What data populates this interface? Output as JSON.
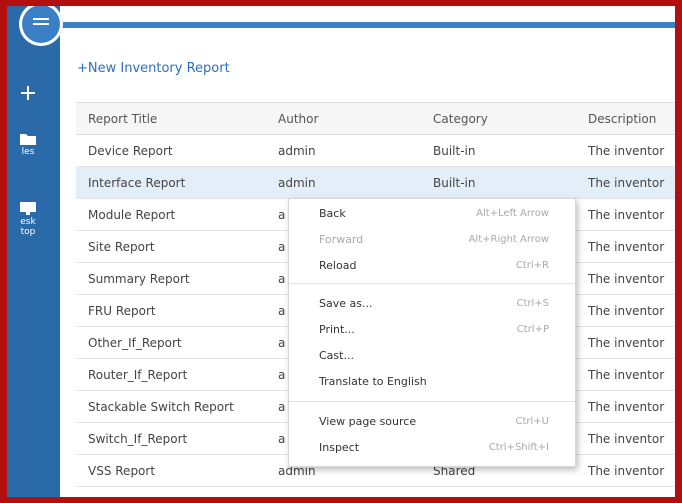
{
  "toolbar": {
    "new_report_link": "+New Inventory Report"
  },
  "sidebar": {
    "files_label": "les",
    "desktop_label_1": "esk",
    "desktop_label_2": "top"
  },
  "table": {
    "headers": [
      "Report Title",
      "Author",
      "Category",
      "Description"
    ],
    "rows": [
      [
        "Device Report",
        "admin",
        "Built-in",
        "The inventor"
      ],
      [
        "Interface Report",
        "admin",
        "Built-in",
        "The inventor"
      ],
      [
        "Module Report",
        "a",
        "",
        "The inventor"
      ],
      [
        "Site Report",
        "a",
        "",
        "The inventor"
      ],
      [
        "Summary Report",
        "a",
        "",
        "The inventor"
      ],
      [
        "FRU Report",
        "a",
        "",
        "The inventor"
      ],
      [
        "Other_If_Report",
        "a",
        "",
        "The inventor"
      ],
      [
        "Router_If_Report",
        "a",
        "",
        "The inventor"
      ],
      [
        "Stackable Switch Report",
        "a",
        "",
        "The inventor"
      ],
      [
        "Switch_If_Report",
        "a",
        "",
        "The inventor"
      ],
      [
        "VSS Report",
        "admin",
        "Shared",
        "The inventor"
      ]
    ]
  },
  "context_menu": {
    "items": [
      {
        "label": "Back",
        "shortcut": "Alt+Left Arrow"
      },
      {
        "label": "Forward",
        "shortcut": "Alt+Right Arrow"
      },
      {
        "label": "Reload",
        "shortcut": "Ctrl+R"
      },
      {
        "label": "Save as...",
        "shortcut": "Ctrl+S"
      },
      {
        "label": "Print...",
        "shortcut": "Ctrl+P"
      },
      {
        "label": "Cast...",
        "shortcut": ""
      },
      {
        "label": "Translate to English",
        "shortcut": ""
      },
      {
        "label": "View page source",
        "shortcut": "Ctrl+U"
      },
      {
        "label": "Inspect",
        "shortcut": "Ctrl+Shift+I"
      }
    ]
  },
  "colors": {
    "frame_border": "#b40f0f",
    "sidebar": "#2b6aa8",
    "accent": "#3b7fc4",
    "row_highlight": "#e4eef9",
    "link": "#2a6fbf"
  }
}
